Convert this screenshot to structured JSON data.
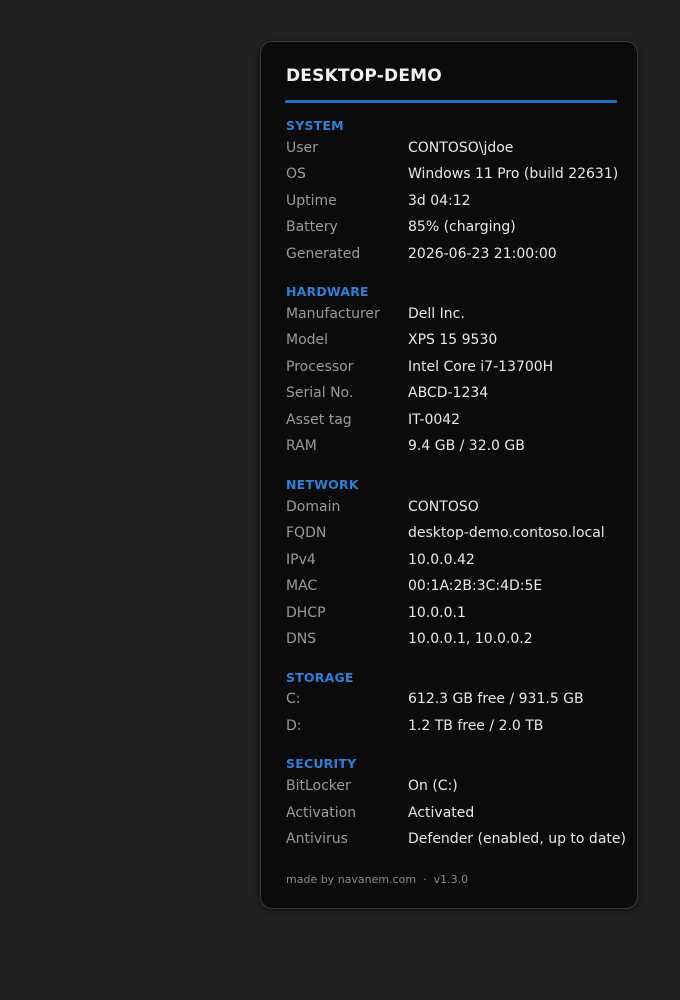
{
  "title": "DESKTOP-DEMO",
  "sections": [
    {
      "title": "SYSTEM",
      "rows": [
        {
          "label": "User",
          "value": "CONTOSO\\jdoe"
        },
        {
          "label": "OS",
          "value": "Windows 11 Pro (build 22631)"
        },
        {
          "label": "Uptime",
          "value": "3d 04:12"
        },
        {
          "label": "Battery",
          "value": "85% (charging)"
        },
        {
          "label": "Generated",
          "value": "2026-06-23 21:00:00"
        }
      ]
    },
    {
      "title": "HARDWARE",
      "rows": [
        {
          "label": "Manufacturer",
          "value": "Dell Inc."
        },
        {
          "label": "Model",
          "value": "XPS 15 9530"
        },
        {
          "label": "Processor",
          "value": "Intel Core i7-13700H"
        },
        {
          "label": "Serial No.",
          "value": "ABCD-1234"
        },
        {
          "label": "Asset tag",
          "value": "IT-0042"
        },
        {
          "label": "RAM",
          "value": "9.4 GB / 32.0 GB"
        }
      ]
    },
    {
      "title": "NETWORK",
      "rows": [
        {
          "label": "Domain",
          "value": "CONTOSO"
        },
        {
          "label": "FQDN",
          "value": "desktop-demo.contoso.local"
        },
        {
          "label": "IPv4",
          "value": "10.0.0.42"
        },
        {
          "label": "MAC",
          "value": "00:1A:2B:3C:4D:5E"
        },
        {
          "label": "DHCP",
          "value": "10.0.0.1"
        },
        {
          "label": "DNS",
          "value": "10.0.0.1, 10.0.0.2"
        }
      ]
    },
    {
      "title": "STORAGE",
      "rows": [
        {
          "label": "C:",
          "value": "612.3 GB free / 931.5 GB"
        },
        {
          "label": "D:",
          "value": "1.2 TB free / 2.0 TB"
        }
      ]
    },
    {
      "title": "SECURITY",
      "rows": [
        {
          "label": "BitLocker",
          "value": "On (C:)"
        },
        {
          "label": "Activation",
          "value": "Activated"
        },
        {
          "label": "Antivirus",
          "value": "Defender (enabled, up to date)"
        }
      ]
    }
  ],
  "footer": {
    "credit": "made by navanem.com",
    "separator": "·",
    "version": "v1.3.0"
  },
  "colors": {
    "accent": "#1f6fc9",
    "section_title": "#2f7fd9",
    "label": "#9a9a9a",
    "value": "#e8e8e8",
    "background": "#212121",
    "panel": "#0b0b0b"
  }
}
